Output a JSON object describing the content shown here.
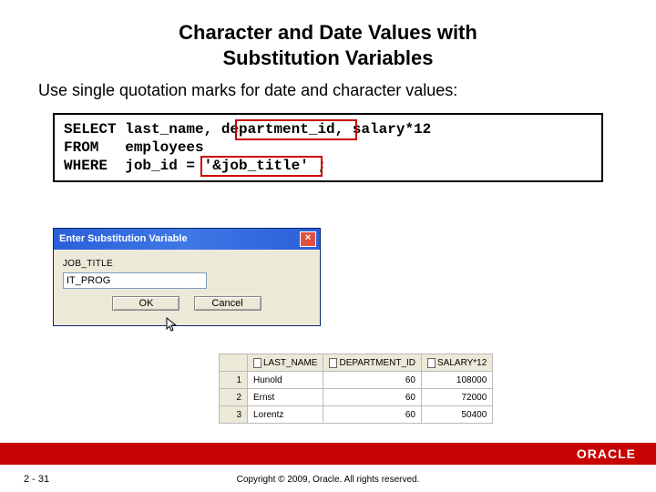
{
  "title_line1": "Character and Date Values with",
  "title_line2": "Substitution Variables",
  "subtitle": "Use single quotation marks for date and character values:",
  "code": {
    "line1": "SELECT last_name, department_id, salary*12",
    "line2": "FROM   employees",
    "line3": "WHERE  job_id = '&job_title' ;"
  },
  "dialog": {
    "title": "Enter Substitution Variable",
    "label": "JOB_TITLE",
    "value": "IT_PROG",
    "ok": "OK",
    "cancel": "Cancel",
    "close_x": "×"
  },
  "result": {
    "headers": [
      "",
      "LAST_NAME",
      "DEPARTMENT_ID",
      "SALARY*12"
    ],
    "rows": [
      {
        "n": "1",
        "last_name": "Hunold",
        "dept": "60",
        "sal": "108000"
      },
      {
        "n": "2",
        "last_name": "Ernst",
        "dept": "60",
        "sal": "72000"
      },
      {
        "n": "3",
        "last_name": "Lorentz",
        "dept": "60",
        "sal": "50400"
      }
    ]
  },
  "footer": {
    "logo": "ORACLE",
    "page": "2 - 31",
    "copyright": "Copyright © 2009, Oracle. All rights reserved."
  }
}
